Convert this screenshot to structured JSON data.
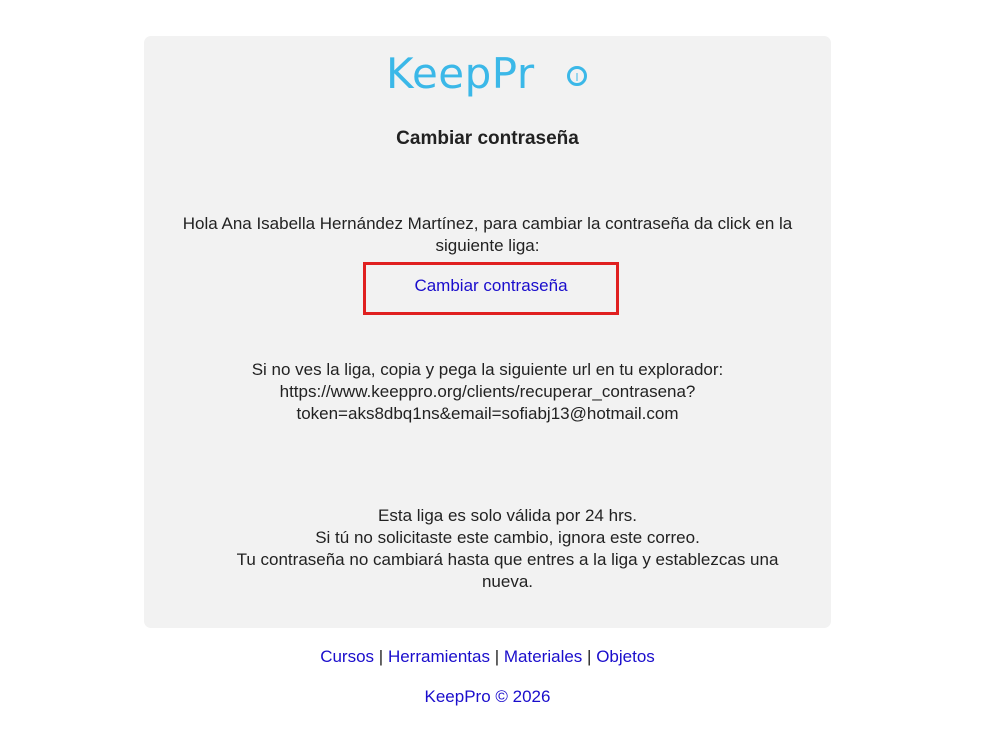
{
  "logo": {
    "text": "KeepPr",
    "color": "#3bb8e8"
  },
  "title": "Cambiar contraseña",
  "greeting": {
    "line1": "Hola Ana Isabella Hernández Martínez, para cambiar la contraseña da click en la",
    "line2": "siguiente liga:"
  },
  "reset_link": {
    "label": "Cambiar contraseña",
    "highlight_color": "#e02020"
  },
  "url_block": {
    "line1": "Si no ves la liga, copia y pega la siguiente url en tu explorador:",
    "line2": "https://www.keeppro.org/clients/recuperar_contrasena?",
    "line3": "token=aks8dbq1ns&email=sofiabj13@hotmail.com"
  },
  "validity": {
    "line1": "Esta liga es solo válida por 24 hrs.",
    "line2": "Si tú no solicitaste este cambio, ignora este correo.",
    "line3": "Tu contraseña no cambiará hasta que entres a la liga y establezcas una",
    "line4": "nueva."
  },
  "footer": {
    "links": [
      "Cursos",
      "Herramientas",
      "Materiales",
      "Objetos"
    ],
    "separator": "|",
    "copyright": "KeepPro © 2026"
  },
  "colors": {
    "card_background": "#f2f2f2",
    "link": "#1a0dcc",
    "text": "#222222"
  }
}
